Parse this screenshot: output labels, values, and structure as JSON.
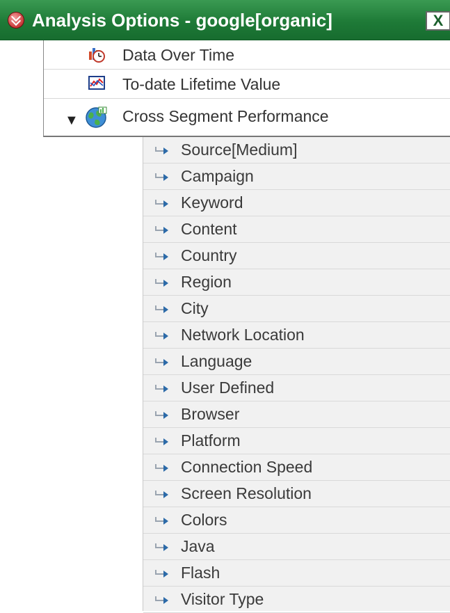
{
  "panel": {
    "title": "Analysis Options - google[organic]",
    "close_label": "X",
    "header_color": "#1e7a37"
  },
  "menu": [
    {
      "label": "Data Over Time",
      "icon": "data-over-time-icon"
    },
    {
      "label": "To-date Lifetime Value",
      "icon": "lifetime-value-icon"
    },
    {
      "label": "Cross Segment Performance",
      "icon": "globe-icon",
      "expanded": true
    }
  ],
  "segments": [
    "Source[Medium]",
    "Campaign",
    "Keyword",
    "Content",
    "Country",
    "Region",
    "City",
    "Network Location",
    "Language",
    "User Defined",
    "Browser",
    "Platform",
    "Connection Speed",
    "Screen Resolution",
    "Colors",
    "Java",
    "Flash",
    "Visitor Type"
  ]
}
